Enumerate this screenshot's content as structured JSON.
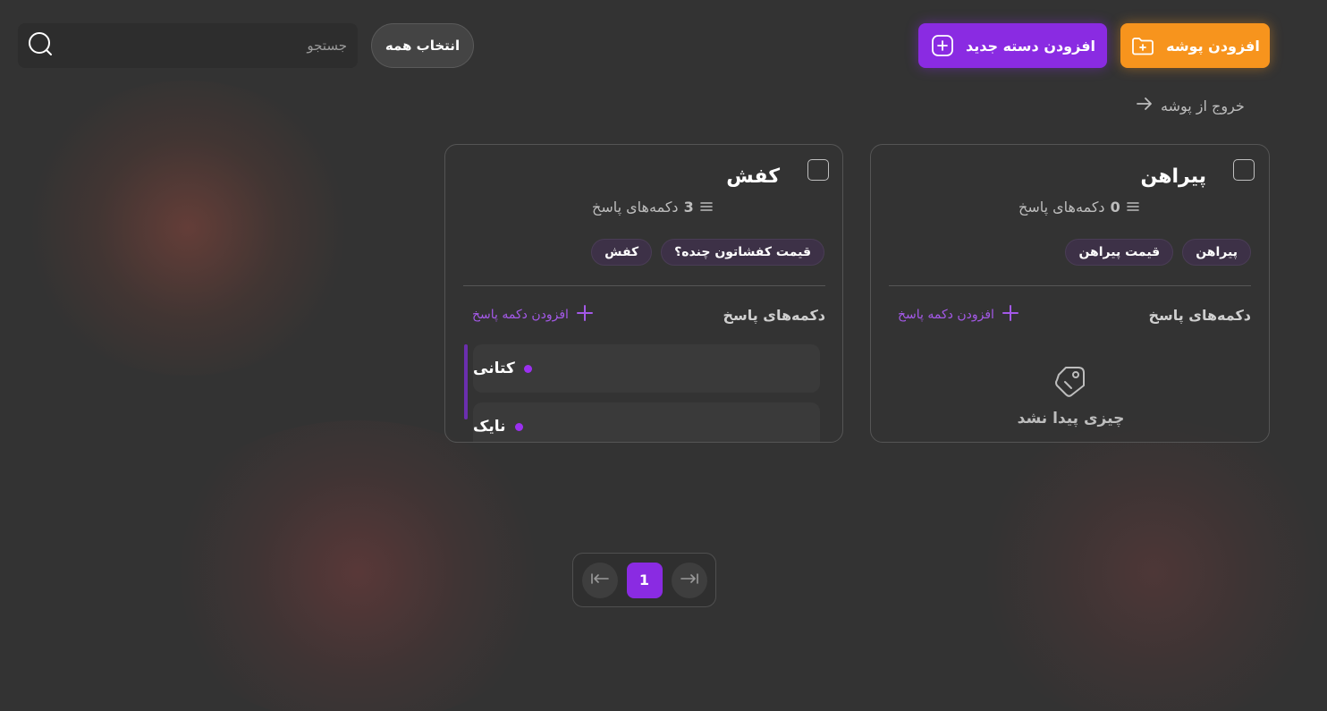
{
  "toolbar": {
    "add_folder_label": "افزودن پوشه",
    "add_category_label": "افزودن دسته جدید",
    "select_all_label": "انتخاب همه",
    "search_placeholder": "جستجو"
  },
  "exit_folder_label": "خروج از پوشه",
  "colors": {
    "accent_orange": "#f7941d",
    "accent_purple": "#8a2be2",
    "background": "#333333"
  },
  "cards": [
    {
      "title": "پیراهن",
      "response_count": "0",
      "response_count_label": "دکمه‌های پاسخ",
      "chips": [
        "پیراهن",
        "قیمت پیراهن"
      ],
      "section_title": "دکمه‌های پاسخ",
      "add_response_label": "افزودن دکمه پاسخ",
      "empty_text": "چیزی پیدا نشد",
      "responses": []
    },
    {
      "title": "کفش",
      "response_count": "3",
      "response_count_label": "دکمه‌های پاسخ",
      "chips": [
        "قیمت کفشاتون چنده؟",
        "کفش"
      ],
      "section_title": "دکمه‌های پاسخ",
      "add_response_label": "افزودن دکمه پاسخ",
      "responses": [
        "کتانی",
        "نایک"
      ]
    }
  ],
  "pagination": {
    "current_page": "1"
  }
}
